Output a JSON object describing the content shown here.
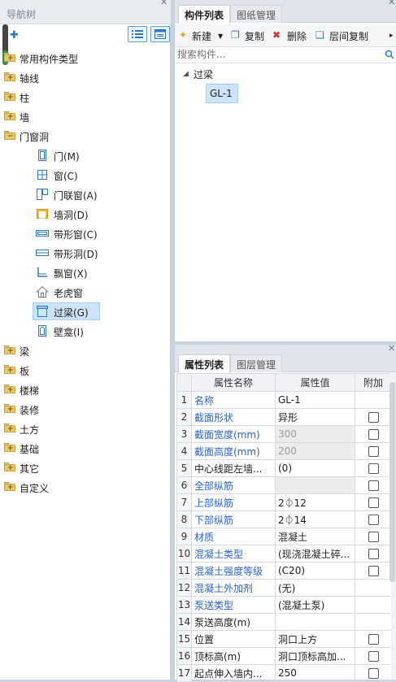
{
  "nav": {
    "title": "导航树",
    "items": [
      {
        "label": "常用构件类型",
        "kind": "folder"
      },
      {
        "label": "轴线",
        "kind": "folder"
      },
      {
        "label": "柱",
        "kind": "folder"
      },
      {
        "label": "墙",
        "kind": "folder"
      },
      {
        "label": "门窗洞",
        "kind": "folder-open"
      },
      {
        "label": "门(M)",
        "kind": "child"
      },
      {
        "label": "窗(C)",
        "kind": "child"
      },
      {
        "label": "门联窗(A)",
        "kind": "child"
      },
      {
        "label": "墙洞(D)",
        "kind": "child"
      },
      {
        "label": "带形窗(C)",
        "kind": "child"
      },
      {
        "label": "带形洞(D)",
        "kind": "child"
      },
      {
        "label": "飘窗(X)",
        "kind": "child"
      },
      {
        "label": "老虎窗",
        "kind": "child"
      },
      {
        "label": "过梁(G)",
        "kind": "child",
        "selected": true
      },
      {
        "label": "壁龛(I)",
        "kind": "child"
      },
      {
        "label": "梁",
        "kind": "folder"
      },
      {
        "label": "板",
        "kind": "folder"
      },
      {
        "label": "楼梯",
        "kind": "folder"
      },
      {
        "label": "装修",
        "kind": "folder"
      },
      {
        "label": "土方",
        "kind": "folder"
      },
      {
        "label": "基础",
        "kind": "folder"
      },
      {
        "label": "其它",
        "kind": "folder"
      },
      {
        "label": "自定义",
        "kind": "folder"
      }
    ]
  },
  "components": {
    "tabs": [
      "构件列表",
      "图纸管理"
    ],
    "toolbar": {
      "new": "新建",
      "copy": "复制",
      "delete": "删除",
      "floor_copy": "层间复制"
    },
    "search_placeholder": "搜索构件...",
    "group": "过梁",
    "selected_item": "GL-1"
  },
  "properties": {
    "tabs": [
      "属性列表",
      "图层管理"
    ],
    "headers": [
      "属性名称",
      "属性值",
      "附加"
    ],
    "rows": [
      {
        "n": "1",
        "name": "名称",
        "value": "GL-1",
        "blue": true,
        "checkbox": false
      },
      {
        "n": "2",
        "name": "截面形状",
        "value": "异形",
        "blue": true,
        "checkbox": true
      },
      {
        "n": "3",
        "name": "截面宽度(mm)",
        "value": "300",
        "blue": true,
        "checkbox": true,
        "disabled": true
      },
      {
        "n": "4",
        "name": "截面高度(mm)",
        "value": "200",
        "blue": true,
        "checkbox": true,
        "disabled": true
      },
      {
        "n": "5",
        "name": "中心线距左墙...",
        "value": "(0)",
        "blue": false,
        "checkbox": true
      },
      {
        "n": "6",
        "name": "全部纵筋",
        "value": "",
        "blue": true,
        "checkbox": true,
        "disabled": true
      },
      {
        "n": "7",
        "name": "上部纵筋",
        "value": "2⏀12",
        "blue": true,
        "checkbox": true
      },
      {
        "n": "8",
        "name": "下部纵筋",
        "value": "2⏀14",
        "blue": true,
        "checkbox": true
      },
      {
        "n": "9",
        "name": "材质",
        "value": "混凝土",
        "blue": true,
        "checkbox": true
      },
      {
        "n": "10",
        "name": "混凝土类型",
        "value": "(现浇混凝土碎...",
        "blue": true,
        "checkbox": true
      },
      {
        "n": "11",
        "name": "混凝土强度等级",
        "value": "(C20)",
        "blue": true,
        "checkbox": true
      },
      {
        "n": "12",
        "name": "混凝土外加剂",
        "value": "(无)",
        "blue": true,
        "checkbox": false
      },
      {
        "n": "13",
        "name": "泵送类型",
        "value": "(混凝土泵)",
        "blue": true,
        "checkbox": false
      },
      {
        "n": "14",
        "name": "泵送高度(m)",
        "value": "",
        "blue": false,
        "checkbox": false
      },
      {
        "n": "15",
        "name": "位置",
        "value": "洞口上方",
        "blue": false,
        "checkbox": true
      },
      {
        "n": "16",
        "name": "顶标高(m)",
        "value": "洞口顶标高加...",
        "blue": false,
        "checkbox": true
      },
      {
        "n": "17",
        "name": "起点伸入墙内...",
        "value": "250",
        "blue": false,
        "checkbox": true
      }
    ]
  }
}
